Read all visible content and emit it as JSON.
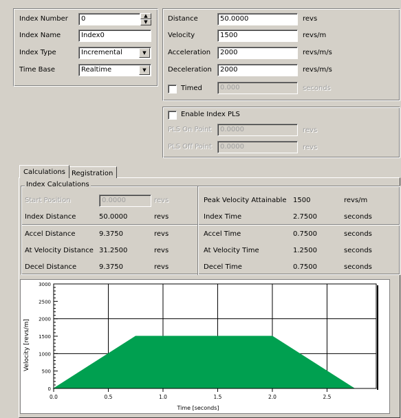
{
  "index_panel": {
    "number_label": "Index Number",
    "number_value": "0",
    "name_label": "Index Name",
    "name_value": "Index0",
    "type_label": "Index Type",
    "type_value": "Incremental",
    "timebase_label": "Time Base",
    "timebase_value": "Realtime"
  },
  "motion_panel": {
    "distance_label": "Distance",
    "distance_value": "50.0000",
    "distance_unit": "revs",
    "velocity_label": "Velocity",
    "velocity_value": "1500",
    "velocity_unit": "revs/m",
    "accel_label": "Acceleration",
    "accel_value": "2000",
    "accel_unit": "revs/m/s",
    "decel_label": "Deceleration",
    "decel_value": "2000",
    "decel_unit": "revs/m/s",
    "timed_label": "Timed",
    "timed_value": "0.000",
    "timed_unit": "seconds"
  },
  "pls_panel": {
    "enable_label": "Enable Index PLS",
    "on_label": "PLS On Point",
    "on_value": "0.0000",
    "on_unit": "revs",
    "off_label": "PLS Off Point",
    "off_value": "0.0000",
    "off_unit": "revs"
  },
  "tabs": [
    "Calculations",
    "Registration"
  ],
  "calc": {
    "group_title": "Index Calculations",
    "left_rows": [
      {
        "label": "Start Position",
        "value": "0.0000",
        "unit": "revs"
      },
      {
        "label": "Index Distance",
        "value": "50.0000",
        "unit": "revs"
      },
      {
        "label": "Accel Distance",
        "value": "9.3750",
        "unit": "revs"
      },
      {
        "label": "At Velocity Distance",
        "value": "31.2500",
        "unit": "revs"
      },
      {
        "label": "Decel Distance",
        "value": "9.3750",
        "unit": "revs"
      }
    ],
    "right_rows": [
      {
        "label": "Peak Velocity Attainable",
        "value": "1500",
        "unit": "revs/m"
      },
      {
        "label": "Index Time",
        "value": "2.7500",
        "unit": "seconds"
      },
      {
        "label": "Accel Time",
        "value": "0.7500",
        "unit": "seconds"
      },
      {
        "label": "At Velocity Time",
        "value": "1.2500",
        "unit": "seconds"
      },
      {
        "label": "Decel Time",
        "value": "0.7500",
        "unit": "seconds"
      }
    ]
  },
  "chart_data": {
    "type": "area",
    "x": [
      0,
      0.75,
      2.0,
      2.75
    ],
    "y": [
      0,
      1500,
      1500,
      0
    ],
    "xlabel": "Time [seconds]",
    "ylabel": "Velocity [revs/m]",
    "xlim": [
      0,
      2.95
    ],
    "ylim": [
      0,
      3000
    ],
    "xticks": [
      "0.0",
      "0.5",
      "1.0",
      "1.5",
      "2.0",
      "2.5"
    ],
    "xtick_values": [
      0,
      0.5,
      1.0,
      1.5,
      2.0,
      2.5
    ],
    "yticks": [
      "0",
      "500",
      "1000",
      "1500",
      "2000",
      "2500",
      "3000"
    ],
    "ytick_values": [
      0,
      500,
      1000,
      1500,
      2000,
      2500,
      3000
    ],
    "grid": true,
    "fill_color": "#00a050"
  }
}
